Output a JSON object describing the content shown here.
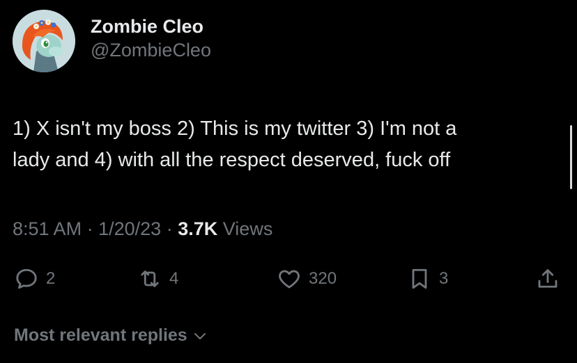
{
  "author": {
    "display_name": "Zombie Cleo",
    "handle": "@ZombieCleo",
    "avatar_icon": "cartoon-pony-avatar"
  },
  "tweet": {
    "text": "1) X isn't my boss 2) This is my twitter 3) I'm not a\nlady and 4) with all the respect deserved, fuck off"
  },
  "meta": {
    "time": "8:51 AM",
    "separator": "·",
    "date": "1/20/23",
    "views_count": "3.7K",
    "views_label": "Views"
  },
  "actions": {
    "reply": {
      "icon": "reply-icon",
      "count": "2"
    },
    "retweet": {
      "icon": "retweet-icon",
      "count": "4"
    },
    "like": {
      "icon": "heart-icon",
      "count": "320"
    },
    "bookmark": {
      "icon": "bookmark-icon",
      "count": "3"
    },
    "share": {
      "icon": "share-icon"
    }
  },
  "replies_filter": {
    "label": "Most relevant replies",
    "icon": "chevron-down-icon"
  },
  "colors": {
    "background": "#000000",
    "primary_text": "#e7e9ea",
    "secondary_text": "#71767b"
  }
}
